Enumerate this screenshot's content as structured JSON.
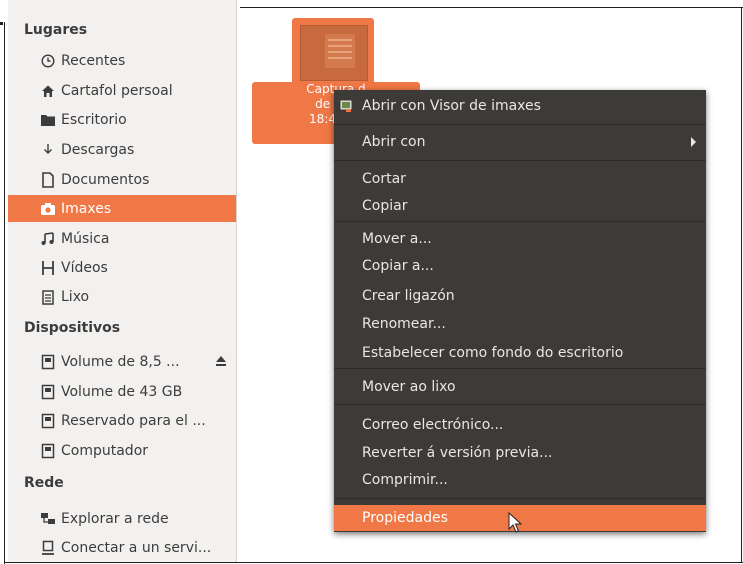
{
  "sidebar": {
    "section_places": "Lugares",
    "section_devices": "Dispositivos",
    "section_network": "Rede",
    "places": [
      {
        "label": "Recentes",
        "icon": "clock-icon"
      },
      {
        "label": "Cartafol persoal",
        "icon": "home-icon"
      },
      {
        "label": "Escritorio",
        "icon": "folder-icon"
      },
      {
        "label": "Descargas",
        "icon": "download-icon"
      },
      {
        "label": "Documentos",
        "icon": "document-icon"
      },
      {
        "label": "Imaxes",
        "icon": "camera-icon",
        "selected": true
      },
      {
        "label": "Música",
        "icon": "music-icon"
      },
      {
        "label": "Vídeos",
        "icon": "film-icon"
      },
      {
        "label": "Lixo",
        "icon": "trash-icon"
      }
    ],
    "devices": [
      {
        "label": "Volume de 8,5 ...",
        "icon": "drive-icon",
        "eject": true
      },
      {
        "label": "Volume de 43 GB",
        "icon": "drive-icon"
      },
      {
        "label": "Reservado para el ...",
        "icon": "drive-icon"
      },
      {
        "label": "Computador",
        "icon": "drive-icon"
      }
    ],
    "network": [
      {
        "label": "Explorar a rede",
        "icon": "network-icon"
      },
      {
        "label": "Conectar a un servi...",
        "icon": "server-icon"
      }
    ]
  },
  "file": {
    "label_line1": "Captura d",
    "label_line2": "de 201",
    "label_line3": "18:41:02"
  },
  "context_menu": {
    "items": [
      {
        "label": "Abrir con Visor de imaxes",
        "icon": "image-viewer-icon"
      },
      {
        "label": "Abrir con",
        "submenu": true
      },
      {
        "label": "Cortar"
      },
      {
        "label": "Copiar"
      },
      {
        "label": "Mover a..."
      },
      {
        "label": "Copiar a..."
      },
      {
        "label": "Crear ligazón"
      },
      {
        "label": "Renomear..."
      },
      {
        "label": "Estabelecer como fondo do escritorio"
      },
      {
        "label": "Mover ao lixo"
      },
      {
        "label": "Correo electrónico..."
      },
      {
        "label": "Reverter á versión previa..."
      },
      {
        "label": "Comprimir..."
      },
      {
        "label": "Propiedades",
        "highlighted": true
      }
    ]
  },
  "colors": {
    "accent": "#f07746",
    "menu_bg": "#3c3b37",
    "sidebar_bg": "#f3f1ef"
  }
}
